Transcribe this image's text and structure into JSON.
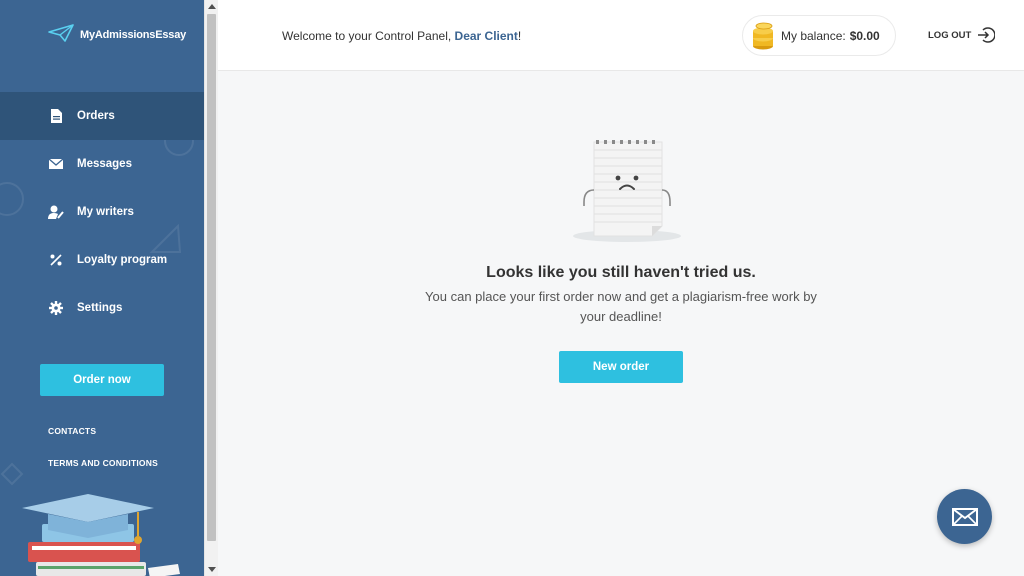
{
  "brand": {
    "name": "MyAdmissionsEssay"
  },
  "sidebar": {
    "items": [
      {
        "label": "Orders",
        "icon": "document-icon"
      },
      {
        "label": "Messages",
        "icon": "envelope-icon"
      },
      {
        "label": "My writers",
        "icon": "writer-icon"
      },
      {
        "label": "Loyalty program",
        "icon": "percent-icon"
      },
      {
        "label": "Settings",
        "icon": "gear-icon"
      }
    ],
    "order_button": "Order now",
    "links": {
      "contacts": "CONTACTS",
      "terms": "TERMS AND CONDITIONS"
    }
  },
  "header": {
    "welcome_text": "Welcome to your Control Panel, ",
    "client_name": "Dear Client",
    "welcome_suffix": "!",
    "balance_label": "My balance:",
    "balance_value": "$0.00",
    "logout_label": "LOG OUT"
  },
  "main": {
    "empty_title": "Looks like you still haven't tried us.",
    "empty_subtitle": "You can place your first order now and get a plagiarism-free work by your deadline!",
    "new_order_button": "New order"
  },
  "colors": {
    "sidebar": "#3c6592",
    "accent": "#2ec0e0",
    "active_item": "#2f5479"
  }
}
